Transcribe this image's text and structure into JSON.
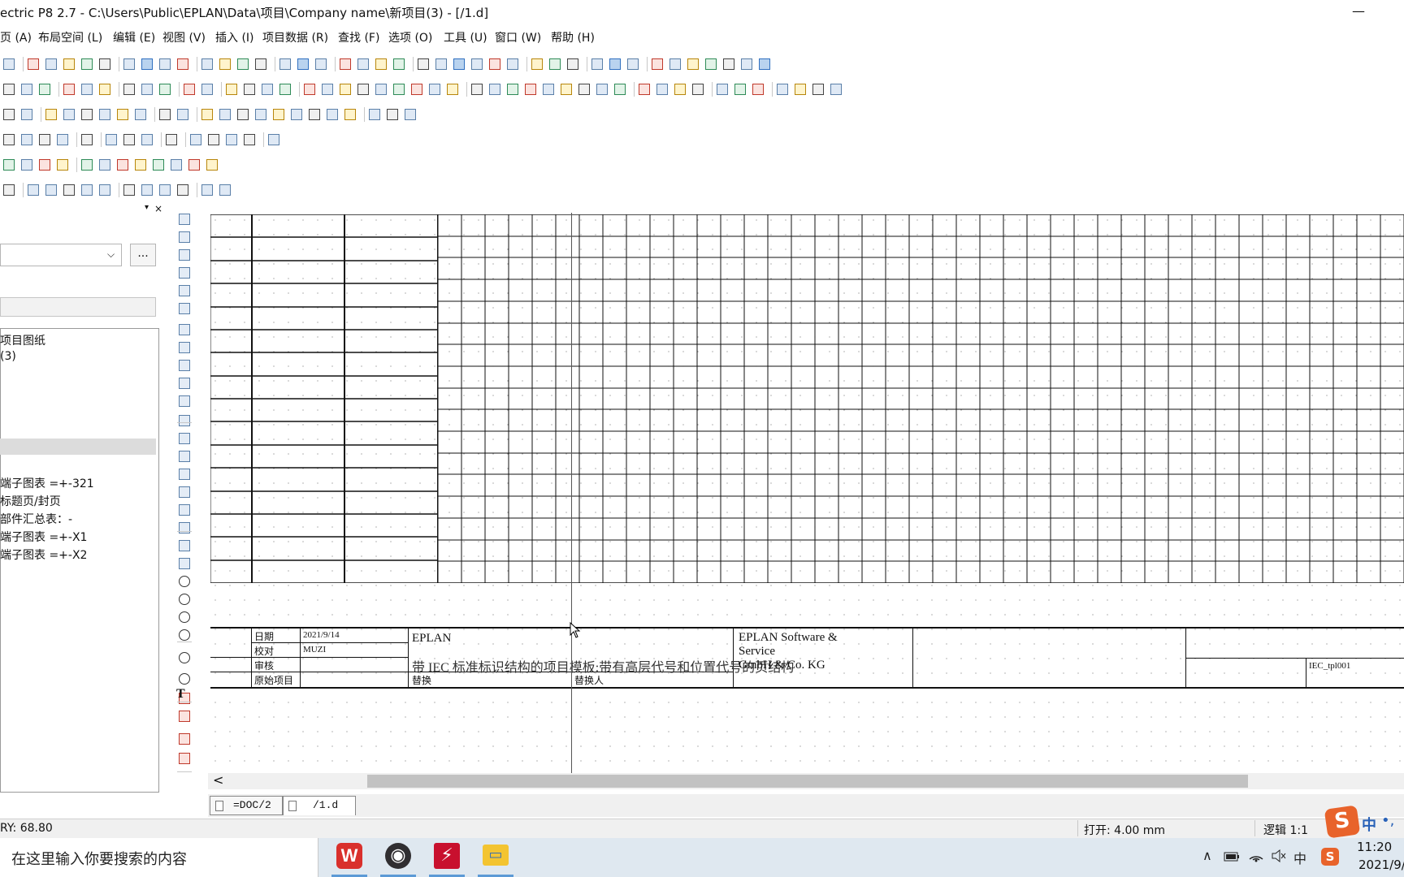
{
  "window": {
    "title": "ectric P8 2.7 - C:\\Users\\Public\\EPLAN\\Data\\项目\\Company name\\新项目(3) - [/1.d]",
    "minimize_glyph": "—"
  },
  "menu": {
    "items": [
      {
        "label": "页 (A)"
      },
      {
        "label": "布局空间 (L)"
      },
      {
        "label": "编辑 (E)"
      },
      {
        "label": "视图 (V)"
      },
      {
        "label": "插入 (I)"
      },
      {
        "label": "项目数据 (R)"
      },
      {
        "label": "查找 (F)"
      },
      {
        "label": "选项 (O)"
      },
      {
        "label": "工具 (U)"
      },
      {
        "label": "窗口 (W)"
      },
      {
        "label": "帮助 (H)"
      }
    ]
  },
  "left_panel": {
    "close_glyph": "×",
    "pin_glyph": "▾",
    "combo_arrow": "⌵",
    "more_button": "...",
    "tree": [
      {
        "label": "项目图纸"
      },
      {
        "label": "(3)"
      },
      {
        "label": "端子图表 =+-321"
      },
      {
        "label": "标题页/封页"
      },
      {
        "label": "部件汇总表：-"
      },
      {
        "label": "端子图表 =+-X1"
      },
      {
        "label": "端子图表 =+-X2"
      }
    ]
  },
  "vertical_toolbar": {
    "text_tool": "T"
  },
  "title_block": {
    "date_label": "日期",
    "date_value": "2021/9/14",
    "check_label": "校对",
    "check_value": "MUZI",
    "review_label": "审核",
    "original_label": "原始项目",
    "replace_label": "替换",
    "replaced_by_label": "替换人",
    "company": "EPLAN",
    "template_desc": "带 IEC 标准标识结构的项目模板:带有高层代号和位置代号的页结构",
    "software_line1": "EPLAN Software &",
    "software_line2": "Service",
    "software_line3": "GmbH & Co. KG",
    "template_id": "IEC_tpl001"
  },
  "scrollbar": {
    "left_arrow": "<"
  },
  "tabs": [
    {
      "label": "=DOC/2"
    },
    {
      "label": "/1.d"
    }
  ],
  "status": {
    "coord": "RY: 68.80",
    "open": "打开: 4.00 mm",
    "logic": "逻辑 1:1"
  },
  "ime": {
    "logo": "S",
    "lang": "中",
    "dots": "•,"
  },
  "taskbar": {
    "search_placeholder": "在这里输入你要搜索的内容",
    "apps": [
      {
        "name": "WPS",
        "glyph": "W"
      },
      {
        "name": "OBS",
        "glyph": "◉"
      },
      {
        "name": "EPLAN",
        "glyph": "⚡"
      },
      {
        "name": "Files",
        "glyph": "▭"
      }
    ],
    "tray": {
      "chevron": "∧",
      "mute_glyph": "🔇",
      "ime": "中",
      "time": "11:20",
      "date": "2021/9/"
    }
  },
  "colors": {
    "accent": "#3070c0",
    "tab_active_bg": "#ffffff",
    "taskbar_bg": "#dfe8f0",
    "ime_brand": "#e8632b"
  }
}
